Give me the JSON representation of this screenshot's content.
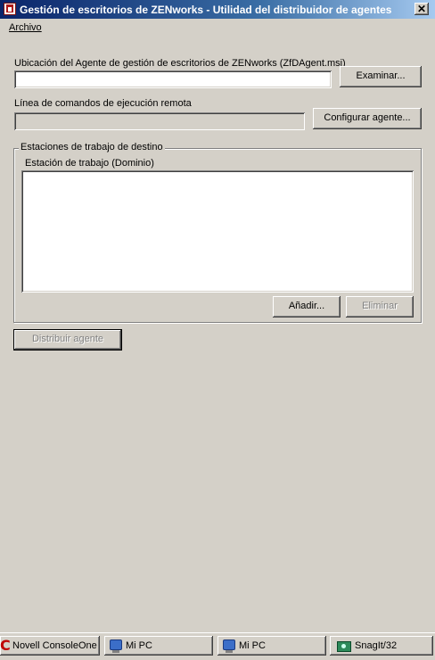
{
  "window": {
    "title": "Gestión de escritorios de ZENworks - Utilidad del distribuidor de agentes",
    "close_glyph": "✕"
  },
  "menu": {
    "file_label": "Archivo"
  },
  "location": {
    "label": "Ubicación del Agente de gestión de escritorios de ZENworks (ZfDAgent.msi)",
    "value": "",
    "browse_button": "Examinar..."
  },
  "remote": {
    "label": "Línea de comandos de ejecución remota",
    "value": "",
    "configure_button": "Configurar agente..."
  },
  "targets": {
    "group_label": "Estaciones de trabajo de destino",
    "column_header": "Estación de trabajo (Dominio)",
    "items": [],
    "add_button": "Añadir...",
    "remove_button": "Eliminar"
  },
  "distribute_button": "Distribuir agente",
  "taskbar": {
    "items": [
      {
        "label": "Novell ConsoleOne",
        "icon": "consoleone-icon"
      },
      {
        "label": "Mi PC",
        "icon": "my-computer-icon"
      },
      {
        "label": "Mi PC",
        "icon": "my-computer-icon"
      },
      {
        "label": "SnagIt/32",
        "icon": "snagit-icon"
      }
    ]
  },
  "colors": {
    "title_bar": "#0a246a",
    "face": "#d4d0c8",
    "accent_red": "#c00000"
  }
}
